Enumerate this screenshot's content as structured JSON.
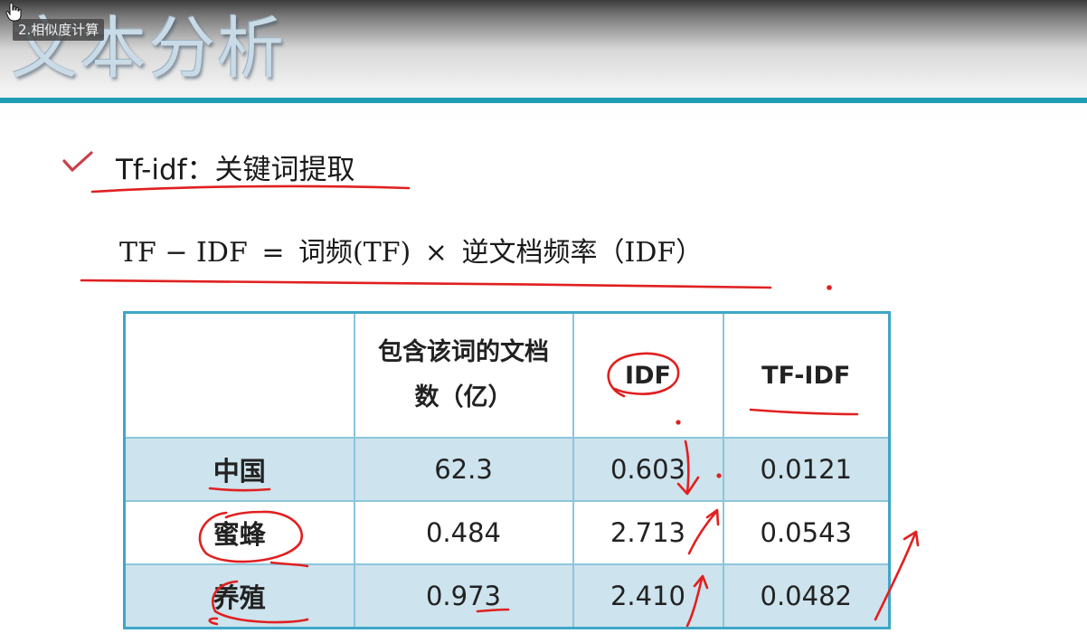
{
  "video": {
    "title": "2.相似度计算"
  },
  "slide": {
    "title": "文本分析",
    "bullet": "Tf-idf：关键词提取",
    "formula": {
      "lhs": "TF − IDF",
      "eq": "=",
      "term1": "词频(TF)",
      "times": "×",
      "term2": "逆文档频率（IDF）"
    },
    "table": {
      "headers": [
        "",
        "包含该词的文档数（亿）",
        "IDF",
        "TF-IDF"
      ],
      "rows": [
        {
          "word": "中国",
          "docs": "62.3",
          "idf": "0.603",
          "tfidf": "0.0121"
        },
        {
          "word": "蜜蜂",
          "docs": "0.484",
          "idf": "2.713",
          "tfidf": "0.0543"
        },
        {
          "word": "养殖",
          "docs": "0.973",
          "idf": "2.410",
          "tfidf": "0.0482"
        }
      ]
    }
  },
  "colors": {
    "title_rule": "#1e9db3",
    "table_border": "#3fa6c6",
    "row_shade": "#cde3ed",
    "annotation_ink": "#e02020"
  },
  "icons": {
    "bullet": "check-icon",
    "cursor": "hand-cursor-icon"
  }
}
